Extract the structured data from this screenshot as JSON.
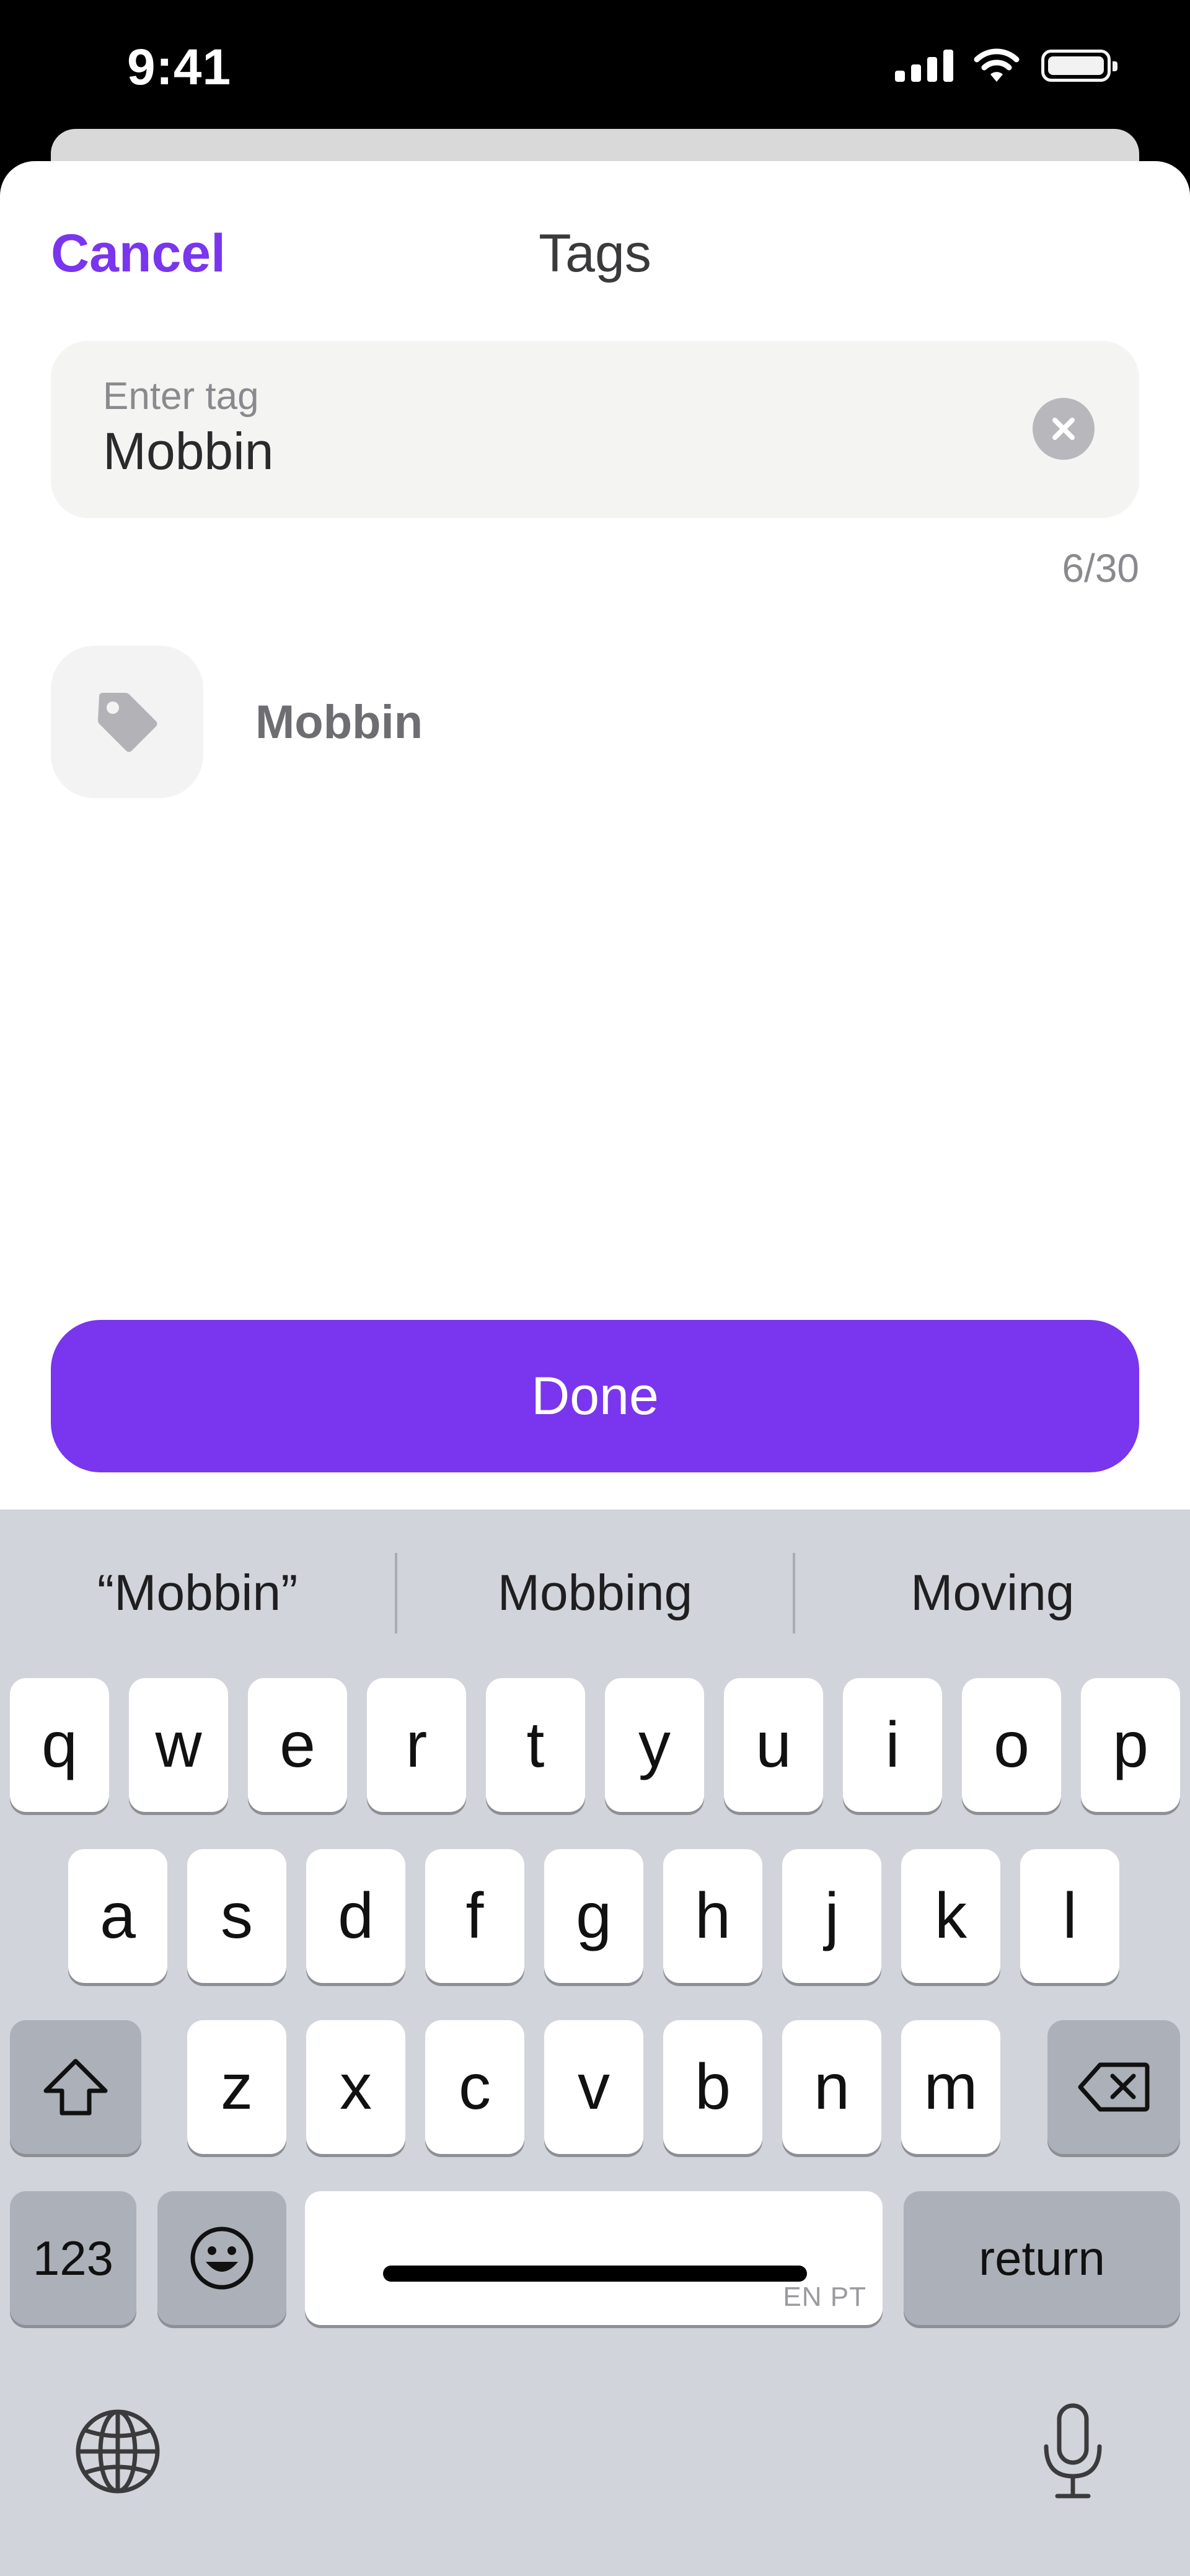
{
  "status_bar": {
    "time": "9:41"
  },
  "sheet": {
    "cancel_label": "Cancel",
    "title": "Tags",
    "input": {
      "label": "Enter tag",
      "value": "Mobbin"
    },
    "char_count": "6/30",
    "suggestions": [
      {
        "label": "Mobbin",
        "icon": "tag-icon"
      }
    ],
    "done_label": "Done"
  },
  "keyboard": {
    "predictions": [
      "“Mobbin”",
      "Mobbing",
      "Moving"
    ],
    "row1": [
      "q",
      "w",
      "e",
      "r",
      "t",
      "y",
      "u",
      "i",
      "o",
      "p"
    ],
    "row2": [
      "a",
      "s",
      "d",
      "f",
      "g",
      "h",
      "j",
      "k",
      "l"
    ],
    "row3": [
      "z",
      "x",
      "c",
      "v",
      "b",
      "n",
      "m"
    ],
    "numbers_label": "123",
    "return_label": "return",
    "space_lang": "EN PT"
  },
  "colors": {
    "accent": "#7a35ee",
    "keyboard_bg": "#d1d4da"
  }
}
